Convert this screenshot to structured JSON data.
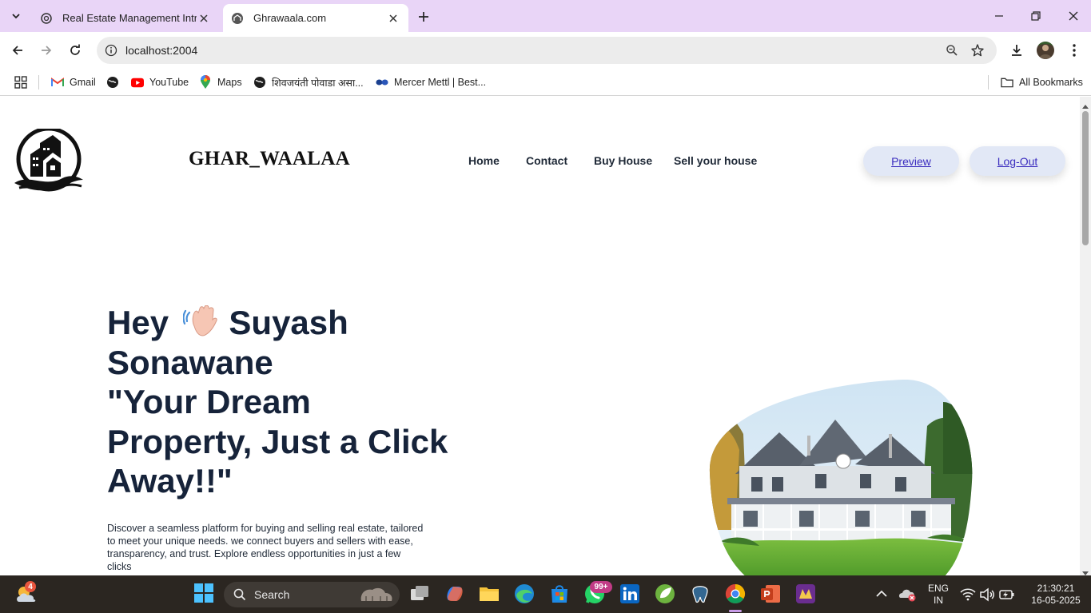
{
  "browser": {
    "tabs": [
      {
        "title": "Real Estate Management Intro"
      },
      {
        "title": "Ghrawaala.com"
      }
    ],
    "url": "localhost:2004",
    "bookmarks": [
      {
        "label": "Gmail"
      },
      {
        "label": ""
      },
      {
        "label": "YouTube"
      },
      {
        "label": "Maps"
      },
      {
        "label": "शिवजयंती पोवाडा असा..."
      },
      {
        "label": "Mercer Mettl | Best..."
      }
    ],
    "all_bookmarks_label": "All Bookmarks"
  },
  "site": {
    "brand": "GHAR_WAALAA",
    "nav": [
      "Home",
      "Contact",
      "Buy House",
      "Sell your house"
    ],
    "preview_label": "Preview",
    "logout_label": "Log-Out",
    "hero": {
      "line1_pre": "Hey",
      "line1_post": " Suyash",
      "line2": "Sonawane",
      "line3": "\"Your Dream",
      "line4": "Property, Just a Click",
      "line5": "Away!!\"",
      "description": "Discover a seamless platform for buying and selling real estate, tailored to meet your unique needs. we connect buyers and sellers with ease, transparency, and trust. Explore endless opportunities in just a few clicks"
    }
  },
  "taskbar": {
    "weather_badge": "4",
    "search_label": "Search",
    "whatsapp_badge": "99+",
    "lang_line1": "ENG",
    "lang_line2": "IN",
    "time": "21:30:21",
    "date": "16-05-2025"
  },
  "colors": {
    "tabstrip": "#e9d5f7",
    "hero_text": "#16233a",
    "pill_bg": "#e2e8f6",
    "pill_link": "#3b2dbf",
    "taskbar": "#2b2621"
  }
}
